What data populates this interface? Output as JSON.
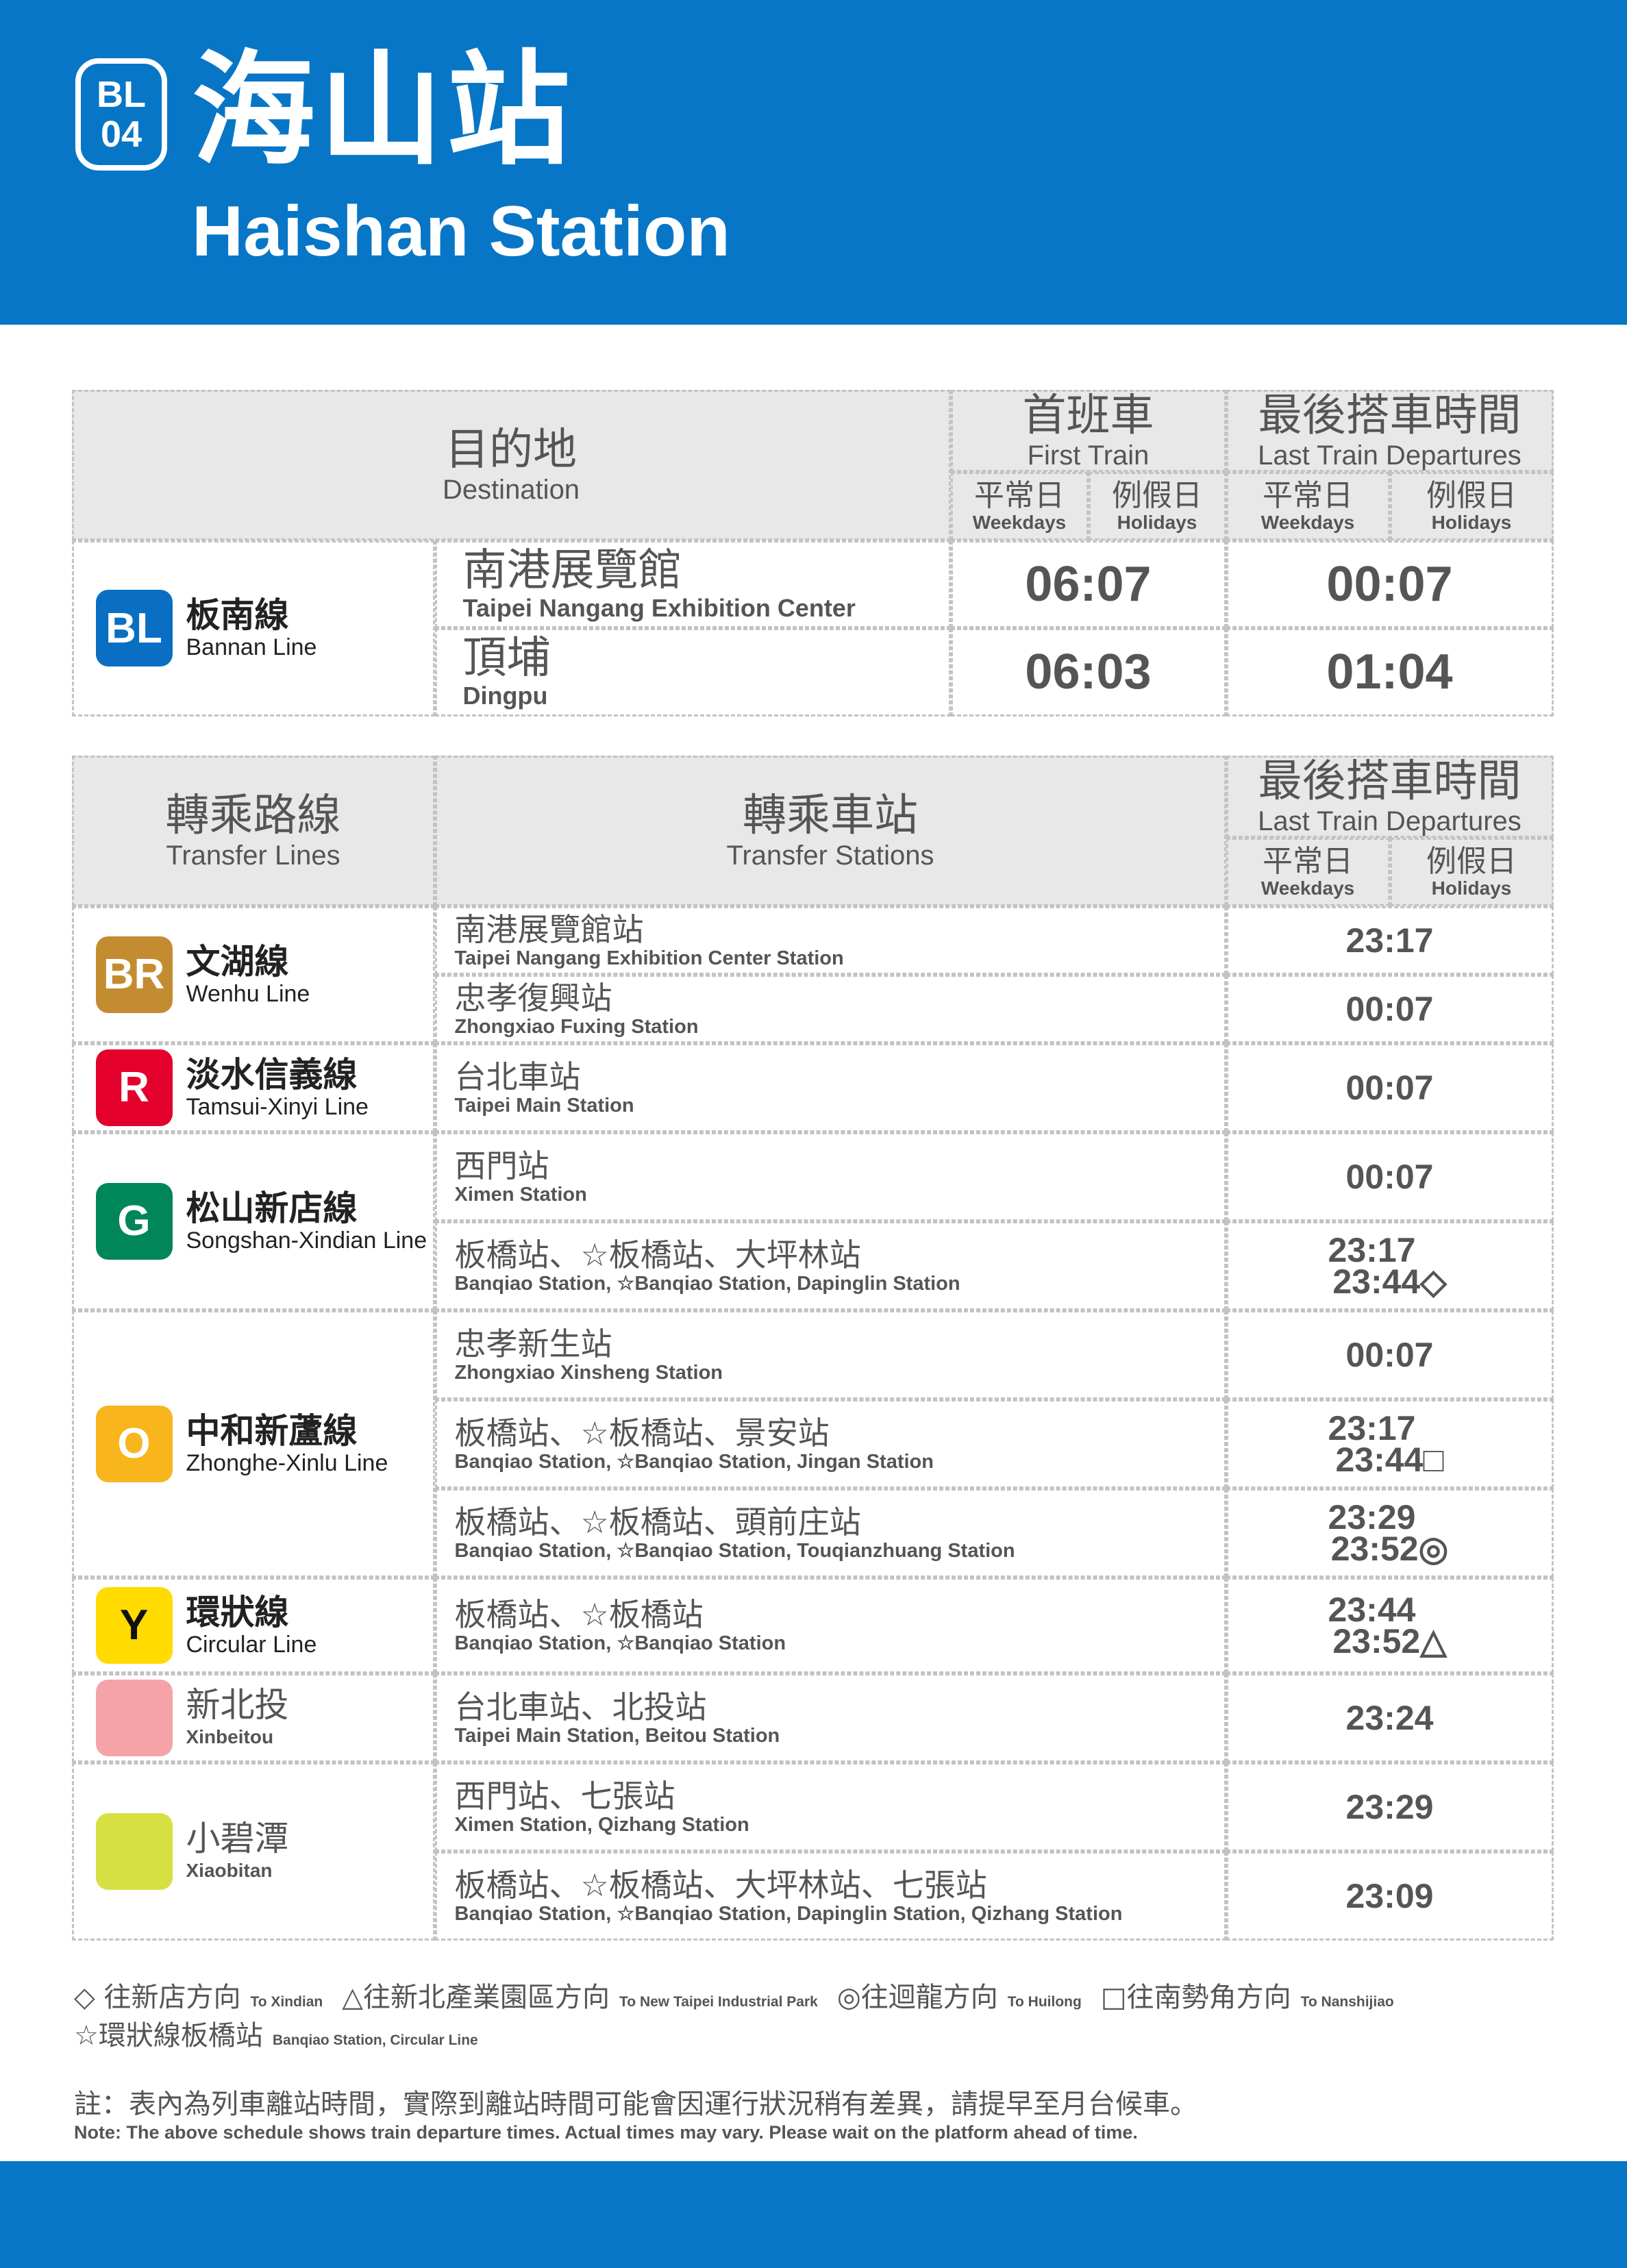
{
  "header": {
    "code_line1": "BL",
    "code_line2": "04",
    "title_zh": "海山站",
    "title_en": "Haishan Station",
    "color": "#0876c6"
  },
  "first_table": {
    "destination_zh": "目的地",
    "destination_en": "Destination",
    "first_train_zh": "首班車",
    "first_train_en": "First Train",
    "last_train_zh": "最後搭車時間",
    "last_train_en": "Last Train Departures",
    "weekdays_zh": "平常日",
    "weekdays_en": "Weekdays",
    "holidays_zh": "例假日",
    "holidays_en": "Holidays",
    "line": {
      "code": "BL",
      "zh": "板南線",
      "en": "Bannan Line",
      "color": "#0a6fc2"
    },
    "rows": [
      {
        "dest_zh": "南港展覽館",
        "dest_en": "Taipei Nangang Exhibition Center",
        "first": "06:07",
        "last": "00:07"
      },
      {
        "dest_zh": "頂埔",
        "dest_en": "Dingpu",
        "first": "06:03",
        "last": "01:04"
      }
    ]
  },
  "transfer_table": {
    "lines_zh": "轉乘路線",
    "lines_en": "Transfer Lines",
    "stations_zh": "轉乘車站",
    "stations_en": "Transfer Stations",
    "last_train_zh": "最後搭車時間",
    "last_train_en": "Last Train Departures",
    "weekdays_zh": "平常日",
    "weekdays_en": "Weekdays",
    "holidays_zh": "例假日",
    "holidays_en": "Holidays",
    "lines": [
      {
        "code": "BR",
        "zh": "文湖線",
        "en": "Wenhu Line",
        "color": "#c48c31",
        "rows": [
          {
            "st_zh": "南港展覽館站",
            "st_en": "Taipei Nangang Exhibition Center Station",
            "t1": "23:17",
            "t2": ""
          },
          {
            "st_zh": "忠孝復興站",
            "st_en": "Zhongxiao Fuxing Station",
            "t1": "00:07",
            "t2": ""
          }
        ]
      },
      {
        "code": "R",
        "zh": "淡水信義線",
        "en": "Tamsui-Xinyi Line",
        "color": "#e3002c",
        "rows": [
          {
            "st_zh": "台北車站",
            "st_en": "Taipei Main Station",
            "t1": "00:07",
            "t2": ""
          }
        ]
      },
      {
        "code": "G",
        "zh": "松山新店線",
        "en": "Songshan-Xindian Line",
        "color": "#008659",
        "rows": [
          {
            "st_zh": "西門站",
            "st_en": "Ximen Station",
            "t1": "00:07",
            "t2": ""
          },
          {
            "st_zh": "板橋站、☆板橋站、大坪林站",
            "st_en": "Banqiao Station, ☆Banqiao Station, Dapinglin Station",
            "t1": "23:17",
            "t2": "23:44◇"
          }
        ]
      },
      {
        "code": "O",
        "zh": "中和新蘆線",
        "en": "Zhonghe-Xinlu Line",
        "color": "#f8b61c",
        "rows": [
          {
            "st_zh": "忠孝新生站",
            "st_en": "Zhongxiao Xinsheng Station",
            "t1": "00:07",
            "t2": ""
          },
          {
            "st_zh": "板橋站、☆板橋站、景安站",
            "st_en": "Banqiao Station, ☆Banqiao Station, Jingan Station",
            "t1": "23:17",
            "t2": "23:44□"
          },
          {
            "st_zh": "板橋站、☆板橋站、頭前庄站",
            "st_en": "Banqiao Station, ☆Banqiao Station, Touqianzhuang Station",
            "t1": "23:29",
            "t2": "23:52◎"
          }
        ]
      },
      {
        "code": "Y",
        "zh": "環狀線",
        "en": "Circular Line",
        "color": "#ffdb00",
        "rows": [
          {
            "st_zh": "板橋站、☆板橋站",
            "st_en": "Banqiao Station, ☆Banqiao Station",
            "t1": "23:44",
            "t2": "23:52△"
          }
        ]
      },
      {
        "code": "",
        "zh": "新北投",
        "en": "Xinbeitou",
        "color": "#f5a3a8",
        "rows": [
          {
            "st_zh": "台北車站、北投站",
            "st_en": "Taipei Main Station, Beitou Station",
            "t1": "23:24",
            "t2": ""
          }
        ]
      },
      {
        "code": "",
        "zh": "小碧潭",
        "en": "Xiaobitan",
        "color": "#d6e043",
        "rows": [
          {
            "st_zh": "西門站、七張站",
            "st_en": "Ximen Station, Qizhang Station",
            "t1": "23:29",
            "t2": ""
          },
          {
            "st_zh": "板橋站、☆板橋站、大坪林站、七張站",
            "st_en": "Banqiao Station, ☆Banqiao Station, Dapinglin Station, Qizhang Station",
            "t1": "23:09",
            "t2": ""
          }
        ]
      }
    ]
  },
  "legend": [
    [
      {
        "zh": "◇ 往新店方向",
        "en": "To Xindian"
      },
      {
        "zh": "△往新北產業園區方向",
        "en": "To New Taipei Industrial Park"
      },
      {
        "zh": "◎往迴龍方向",
        "en": "To Huilong"
      },
      {
        "zh": "□往南勢角方向",
        "en": "To Nanshijiao"
      }
    ],
    [
      {
        "zh": "☆環狀線板橋站",
        "en": "Banqiao Station, Circular Line"
      }
    ]
  ],
  "note": {
    "zh": "註：表內為列車離站時間，實際到離站時間可能會因運行狀況稍有差異，請提早至月台候車。",
    "en": "Note: The above schedule shows train departure times. Actual times may vary. Please wait on the platform ahead of time."
  }
}
